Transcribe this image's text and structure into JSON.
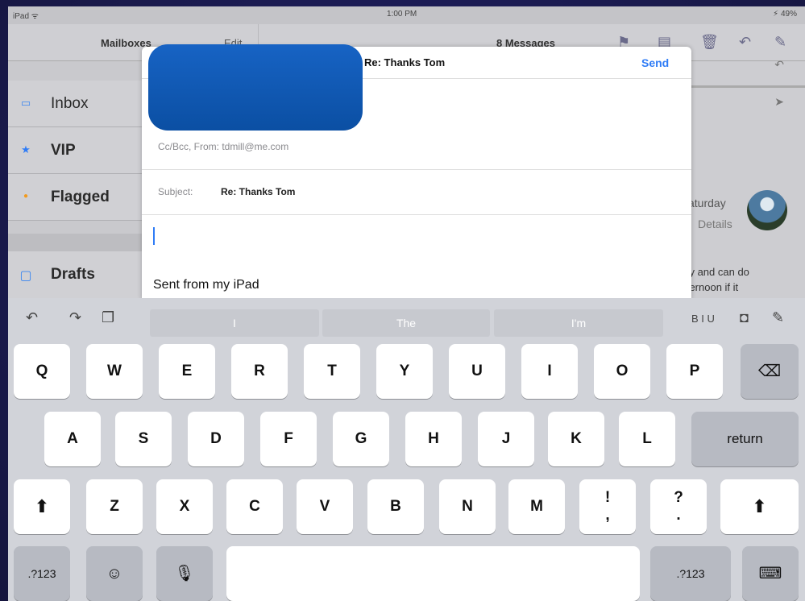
{
  "status_bar": {
    "carrier": "iPad ᯤ",
    "time": "1:00 PM",
    "battery": "⚡ 49%"
  },
  "mailbox": {
    "title": "Mailboxes",
    "edit": "Edit",
    "items": [
      {
        "label": "Inbox",
        "icon": "inbox-icon",
        "glyph": "▭"
      },
      {
        "label": "VIP",
        "icon": "star-icon",
        "glyph": "★"
      },
      {
        "label": "Flagged",
        "icon": "flag-dot-icon",
        "glyph": "●"
      },
      {
        "label": "Drafts",
        "icon": "document-icon",
        "glyph": "▢"
      }
    ]
  },
  "message_list": {
    "count": "8 Messages",
    "preview_saturday": "aturday",
    "preview_details": "Details",
    "preview_line1": "day and can do",
    "preview_line2": "afternoon if it"
  },
  "compose": {
    "title": "Re: Thanks Tom",
    "send": "Send",
    "cc_from": "Cc/Bcc, From: tdmill@me.com",
    "subject_label": "Subject:",
    "subject_value": "Re: Thanks Tom",
    "signature": "Sent from my iPad"
  },
  "keyboard": {
    "suggestions": [
      "I",
      "The",
      "I'm"
    ],
    "format_label": "B I U",
    "row1": [
      "Q",
      "W",
      "E",
      "R",
      "T",
      "Y",
      "U",
      "I",
      "O",
      "P"
    ],
    "row2": [
      "A",
      "S",
      "D",
      "F",
      "G",
      "H",
      "J",
      "K",
      "L"
    ],
    "row3": [
      "Z",
      "X",
      "C",
      "V",
      "B",
      "N",
      "M"
    ],
    "return": "return",
    "numbers": ".?123",
    "excl": "!",
    "comma": ",",
    "question": "?",
    "period": "."
  },
  "colors": {
    "accent": "#2f7cf6",
    "redaction": "#0b4fa3"
  }
}
